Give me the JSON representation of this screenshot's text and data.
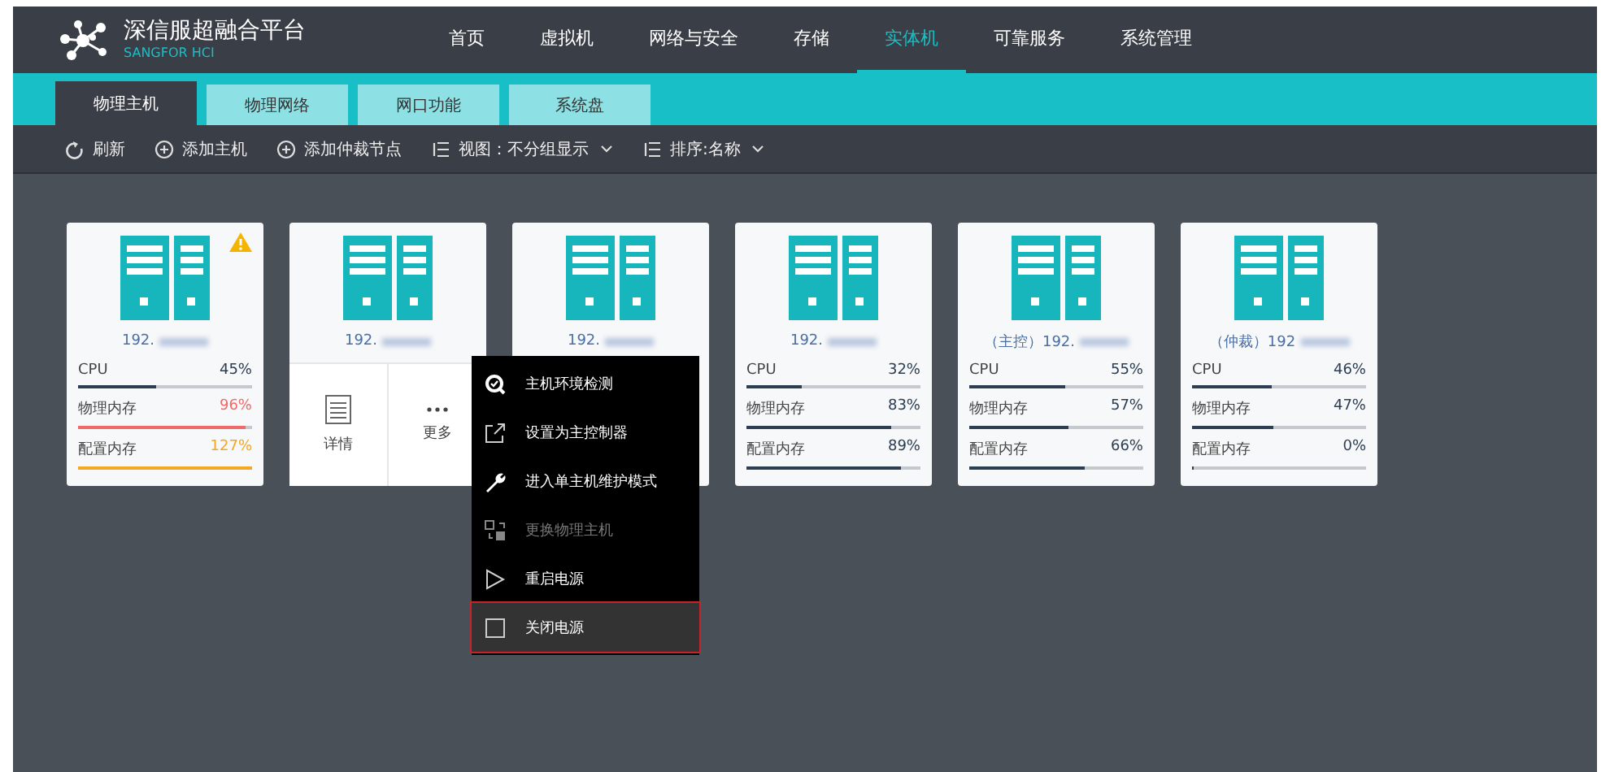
{
  "header": {
    "logo_title": "深信服超融合平台",
    "logo_subtitle": "SANGFOR HCI",
    "nav": [
      {
        "label": "首页",
        "selected": false
      },
      {
        "label": "虚拟机",
        "selected": false
      },
      {
        "label": "网络与安全",
        "selected": false
      },
      {
        "label": "存储",
        "selected": false
      },
      {
        "label": "实体机",
        "selected": true
      },
      {
        "label": "可靠服务",
        "selected": false
      },
      {
        "label": "系统管理",
        "selected": false
      }
    ]
  },
  "tabs": [
    {
      "label": "物理主机",
      "selected": true
    },
    {
      "label": "物理网络",
      "selected": false
    },
    {
      "label": "网口功能",
      "selected": false
    },
    {
      "label": "系统盘",
      "selected": false
    }
  ],
  "toolbar": [
    {
      "kind": "refresh",
      "label": "刷新"
    },
    {
      "kind": "add",
      "label": "添加主机"
    },
    {
      "kind": "add",
      "label": "添加仲裁节点"
    },
    {
      "kind": "list",
      "label": "视图：不分组显示"
    },
    {
      "kind": "list",
      "label": "排序:名称"
    }
  ],
  "hosts": [
    {
      "ip": "192.",
      "warning": true,
      "metrics": [
        {
          "label": "CPU",
          "value": "45%",
          "level": 0.45,
          "color": "#2d3e52"
        },
        {
          "label": "物理内存",
          "value": "96%",
          "level": 0.96,
          "color": "#f06a6a"
        },
        {
          "label": "配置内存",
          "value": "127%",
          "level": 1,
          "color": "#f5a623"
        }
      ]
    },
    {
      "ip": "192.",
      "warning": false,
      "actions": [
        {
          "kind": "details",
          "label": "详情"
        },
        {
          "kind": "more",
          "label": "更多"
        }
      ]
    },
    {
      "ip": "192.",
      "warning": false
    },
    {
      "ip": "192.",
      "warning": false,
      "metrics": [
        {
          "label": "CPU",
          "value": "32%",
          "level": 0.32,
          "color": "#2d3e52"
        },
        {
          "label": "物理内存",
          "value": "83%",
          "level": 0.83,
          "color": "#2d3e52"
        },
        {
          "label": "配置内存",
          "value": "89%",
          "level": 0.89,
          "color": "#2d3e52"
        }
      ]
    },
    {
      "ip": "（主控）192.",
      "warning": false,
      "metrics": [
        {
          "label": "CPU",
          "value": "55%",
          "level": 0.55,
          "color": "#2d3e52"
        },
        {
          "label": "物理内存",
          "value": "57%",
          "level": 0.57,
          "color": "#2d3e52"
        },
        {
          "label": "配置内存",
          "value": "66%",
          "level": 0.66,
          "color": "#2d3e52"
        }
      ]
    },
    {
      "ip": "（仲裁）192",
      "warning": false,
      "metrics": [
        {
          "label": "CPU",
          "value": "46%",
          "level": 0.46,
          "color": "#2d3e52"
        },
        {
          "label": "物理内存",
          "value": "47%",
          "level": 0.47,
          "color": "#2d3e52"
        },
        {
          "label": "配置内存",
          "value": "0%",
          "level": 0,
          "color": "#2d3e52"
        }
      ]
    }
  ],
  "context_menu": [
    {
      "kind": "check",
      "label": "主机环境检测",
      "disabled": false,
      "highlighted": false
    },
    {
      "kind": "export",
      "label": "设置为主控制器",
      "disabled": false,
      "highlighted": false
    },
    {
      "kind": "wrench",
      "label": "进入单主机维护模式",
      "disabled": false,
      "highlighted": false
    },
    {
      "kind": "swap",
      "label": "更换物理主机",
      "disabled": true,
      "highlighted": false
    },
    {
      "kind": "play",
      "label": "重启电源",
      "disabled": false,
      "highlighted": false
    },
    {
      "kind": "square",
      "label": "关闭电源",
      "disabled": false,
      "highlighted": true
    }
  ]
}
